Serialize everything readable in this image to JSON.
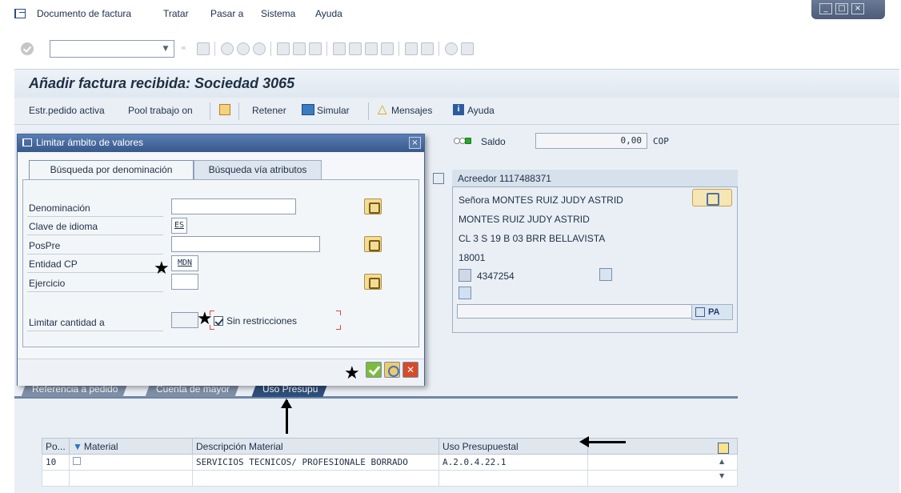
{
  "menu": {
    "items": [
      "Documento de factura",
      "Tratar",
      "Pasar a",
      "Sistema",
      "Ayuda"
    ]
  },
  "title": "Añadir factura recibida: Sociedad 3065",
  "app_toolbar": {
    "estr_pedido": "Estr.pedido activa",
    "pool_trabajo": "Pool trabajo on",
    "retener": "Retener",
    "simular": "Simular",
    "mensajes": "Mensajes",
    "ayuda": "Ayuda"
  },
  "saldo": {
    "label": "Saldo",
    "value": "0,00",
    "currency": "COP"
  },
  "vendor": {
    "title": "Acreedor 1117488371",
    "line1": "Señora MONTES RUIZ JUDY ASTRID",
    "line2": "MONTES RUIZ JUDY ASTRID",
    "line3": "CL 3 S 19 B 03 BRR BELLAVISTA",
    "line4": "18001",
    "phone": "4347254",
    "pa_label": "PA"
  },
  "dialog": {
    "title": "Limitar ámbito de valores",
    "tabs": [
      "Búsqueda por denominación",
      "Búsqueda vía atributos"
    ],
    "fields": {
      "denominacion": {
        "label": "Denominación",
        "value": ""
      },
      "clave_idioma": {
        "label": "Clave de idioma",
        "value": "ES"
      },
      "pospre": {
        "label": "PosPre",
        "value": ""
      },
      "entidad_cp": {
        "label": "Entidad CP",
        "value": "MDN"
      },
      "ejercicio": {
        "label": "Ejercicio",
        "value": ""
      },
      "limitar": {
        "label": "Limitar cantidad a",
        "value": ""
      }
    },
    "sin_restricciones": "Sin restricciones"
  },
  "bottom_tabs": [
    "Referencia a pedido",
    "Cuenta de mayor",
    "Uso Presupu"
  ],
  "table": {
    "headers": [
      "Po...",
      "Material",
      "Descripción Material",
      "Uso Presupuestal"
    ],
    "rows": [
      [
        "10",
        "",
        "SERVICIOS TECNICOS/ PROFESIONALE BORRADO",
        "A.2.0.4.22.1"
      ],
      [
        "",
        "",
        "",
        ""
      ]
    ]
  },
  "colors": {
    "title_bar": "#dfe7f0",
    "dialog_header": "#38598c",
    "ok_button": "#7cbc3b",
    "cancel_button": "#d74b28"
  }
}
